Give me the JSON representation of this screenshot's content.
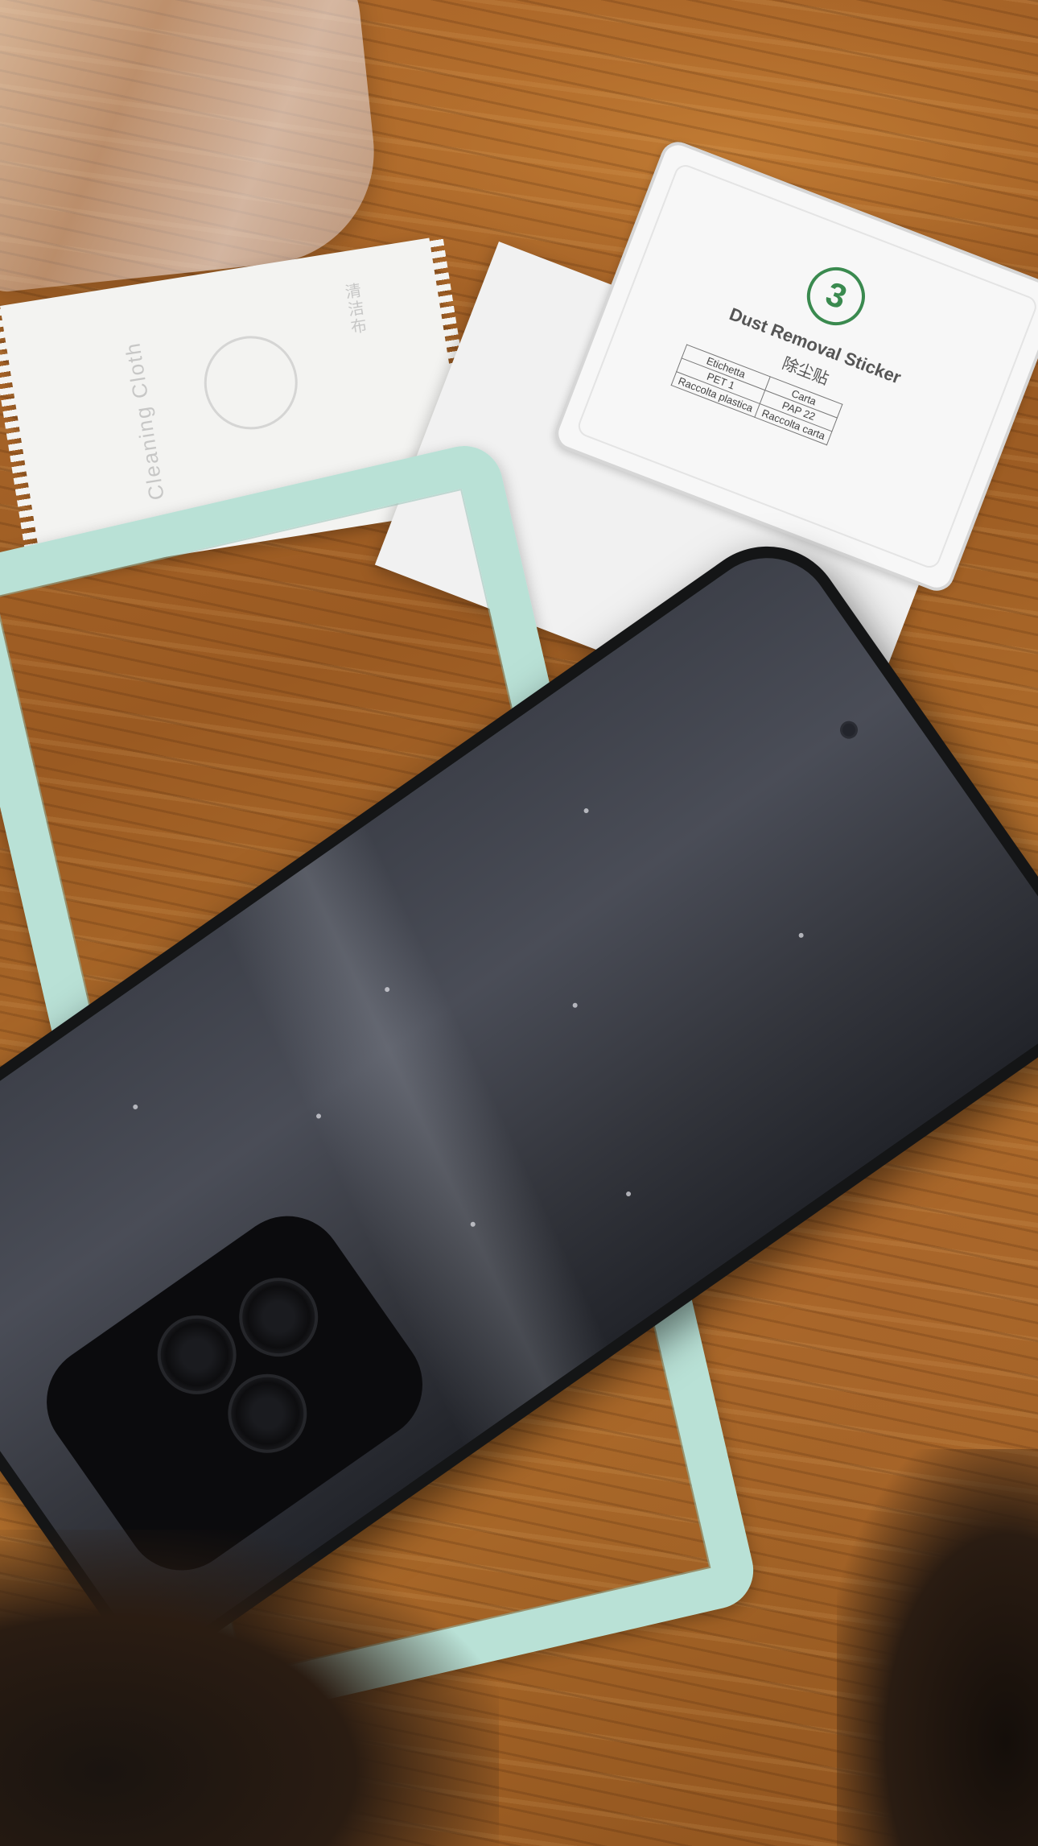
{
  "scene": {
    "description_items": {
      "bag": "plastic-bag",
      "cloth": "cleaning-cloth",
      "sticker": "dust-removal-sticker",
      "frame": "alignment-frame",
      "phone": "smartphone"
    },
    "cloth": {
      "text_1": "Cleaning Cloth",
      "text_2": "清洁布"
    },
    "sticker": {
      "number": "3",
      "title": "Dust Removal Sticker",
      "subtitle": "除尘贴",
      "table": {
        "header": [
          "Etichetta",
          "Carta"
        ],
        "row1": [
          "PET 1",
          "PAP 22"
        ],
        "row2": [
          "Raccolta plastica",
          "Raccolta carta"
        ]
      }
    },
    "colors": {
      "table_wood": "#a8652a",
      "frame_mint": "#b9e1d6",
      "sticker_accent": "#3a8a4f",
      "phone_body": "#141516"
    }
  }
}
